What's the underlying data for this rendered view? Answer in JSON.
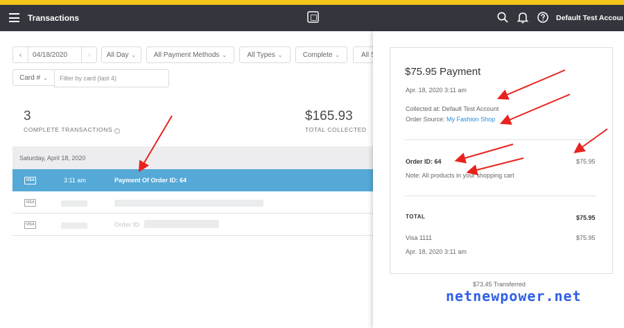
{
  "topbar": {
    "title": "Transactions",
    "account": "Default Test Account"
  },
  "filters": {
    "date": "04/18/2020",
    "time": "All Day",
    "payment_methods": "All Payment Methods",
    "types": "All Types",
    "status": "Complete",
    "sources": "All S",
    "card_label": "Card #",
    "card_placeholder": "Filter by card (last 4)"
  },
  "summary": {
    "count": "3",
    "count_label": "COMPLETE TRANSACTIONS",
    "total": "$165.93",
    "total_label": "TOTAL COLLECTED"
  },
  "transactions": {
    "day_header": "Saturday, April 18, 2020",
    "rows": [
      {
        "card": "VISA",
        "time": "3:11 am",
        "description": "Payment Of Order ID: 64"
      },
      {
        "card": "VISA",
        "time": "",
        "description": ""
      },
      {
        "card": "VISA",
        "time": "",
        "description": "Order ID"
      }
    ]
  },
  "receipt": {
    "title": "$75.95 Payment",
    "datetime": "Apr. 18, 2020 3:11 am",
    "collected_at": "Collected at: Default Test Account",
    "order_source_label": "Order Source:",
    "order_source_value": "My Fashion Shop",
    "order_id": "Order ID: 64",
    "order_amount": "$75.95",
    "note": "Note: All products in your shopping cart",
    "total_label": "TOTAL",
    "total_amount": "$75.95",
    "tender": "Visa 1111",
    "tender_amount": "$75.95",
    "tender_datetime": "Apr. 18, 2020 3:11 am",
    "transferred": "$73.45 Transferred"
  },
  "watermark": "netnewpower.net",
  "colors": {
    "accent_bar": "#f5c51a",
    "topbar": "#33373d",
    "selected_row": "#2f97cf",
    "link": "#2a8ad6",
    "arrow": "#e8231d",
    "watermark": "#2f5fe8"
  }
}
